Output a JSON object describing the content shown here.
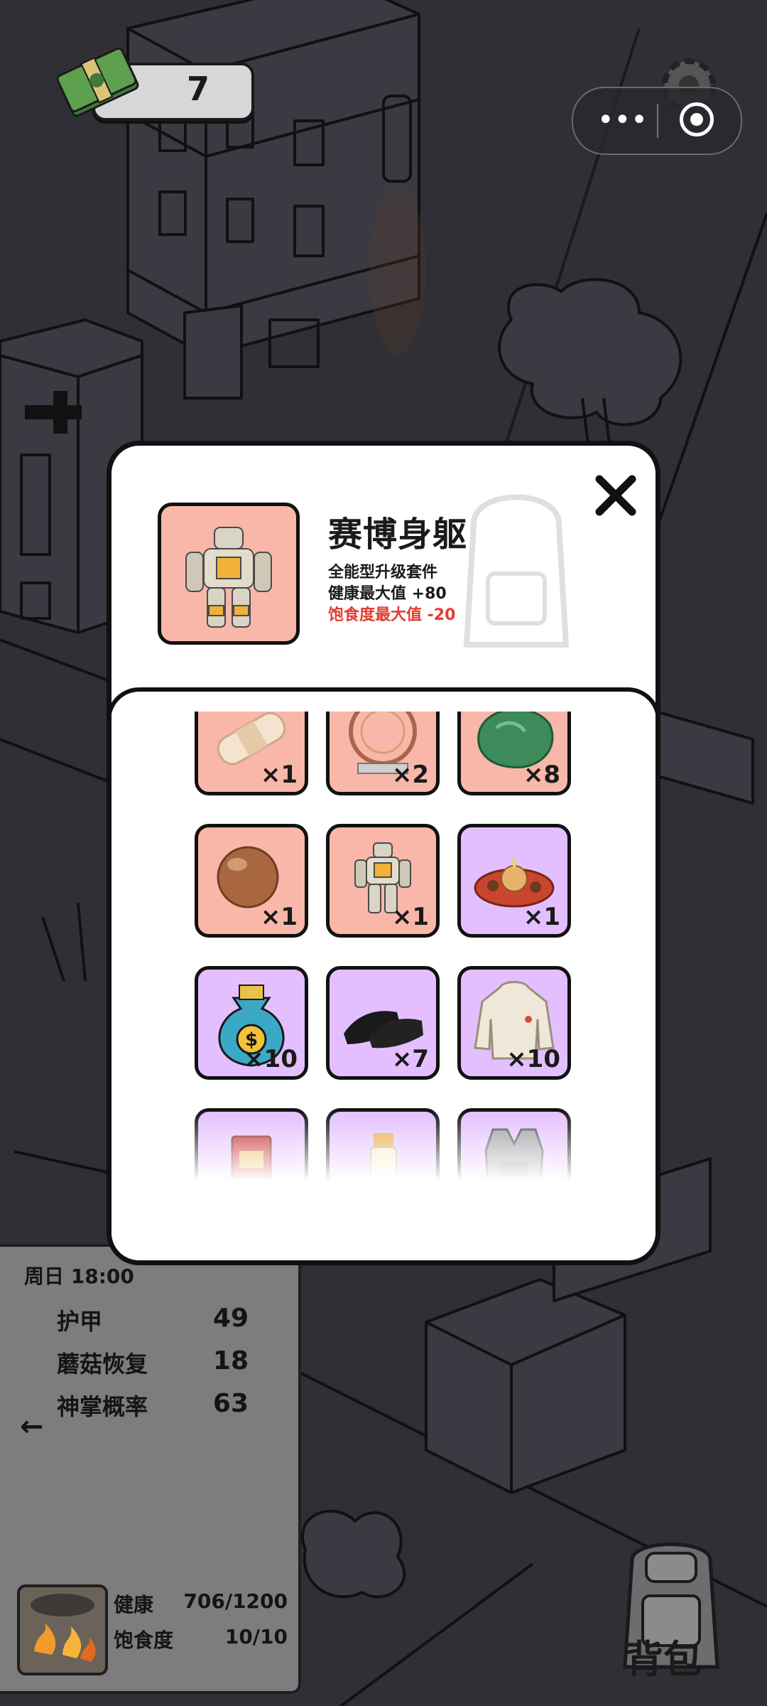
{
  "hud": {
    "money": "7"
  },
  "capsule": {
    "menu_icon": "more-dots-icon",
    "close_icon": "target-icon"
  },
  "detail": {
    "title": "赛博身躯",
    "line1": "全能型升级套件",
    "line2": "健康最大值 +80",
    "line3": "饱食度最大值 -20",
    "negative_color": "#e53b2f",
    "icon": "robot-mech-icon"
  },
  "inventory": {
    "items": [
      {
        "name": "bandage",
        "icon": "bandage-icon",
        "count": "×1",
        "rarity": "orange"
      },
      {
        "name": "wheel-device",
        "icon": "wheel-machine-icon",
        "count": "×2",
        "rarity": "orange"
      },
      {
        "name": "green-ore",
        "icon": "jade-stone-icon",
        "count": "×8",
        "rarity": "orange"
      },
      {
        "name": "brown-ball",
        "icon": "ball-icon",
        "count": "×1",
        "rarity": "orange"
      },
      {
        "name": "cyber-body",
        "icon": "robot-mech-icon",
        "count": "×1",
        "rarity": "orange"
      },
      {
        "name": "food-plate",
        "icon": "food-plate-icon",
        "count": "×1",
        "rarity": "purple"
      },
      {
        "name": "money-bag",
        "icon": "money-bag-icon",
        "count": "×10",
        "rarity": "purple"
      },
      {
        "name": "black-shoes",
        "icon": "shoes-icon",
        "count": "×7",
        "rarity": "purple"
      },
      {
        "name": "hoodie",
        "icon": "hoodie-icon",
        "count": "×10",
        "rarity": "purple"
      },
      {
        "name": "red-envelope",
        "icon": "red-envelope-icon",
        "count": "",
        "rarity": "purple"
      },
      {
        "name": "sunscreen",
        "icon": "tube-icon",
        "count": "",
        "rarity": "purple"
      },
      {
        "name": "vest",
        "icon": "armor-vest-icon",
        "count": "",
        "rarity": "purple"
      }
    ],
    "colors": {
      "orange": "#f8b7a8",
      "purple": "#e4bfff"
    }
  },
  "stats": {
    "time": "周日 18:00",
    "armor_label": "护甲",
    "armor_value": "49",
    "mushroom_label": "蘑菇恢复",
    "mushroom_value": "18",
    "palm_label": "神掌概率",
    "palm_value": "63",
    "health_label": "健康",
    "health_value": "706/1200",
    "satiety_label": "饱食度",
    "satiety_value": "10/10"
  },
  "backpack": {
    "label": "背包"
  }
}
